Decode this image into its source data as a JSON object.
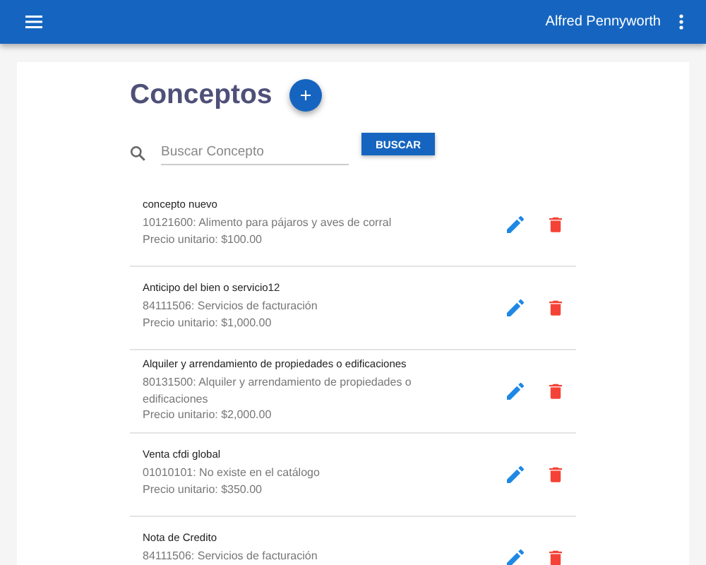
{
  "app_bar": {
    "user_name": "Alfred Pennyworth"
  },
  "page": {
    "title": "Conceptos"
  },
  "search": {
    "placeholder": "Buscar Concepto",
    "button": "BUSCAR"
  },
  "items": [
    {
      "name": "concepto nuevo",
      "code": "10121600: Alimento para pájaros y aves de corral",
      "price": "Precio unitario: $100.00"
    },
    {
      "name": "Anticipo del bien o servicio12",
      "code": "84111506: Servicios de facturación",
      "price": "Precio unitario: $1,000.00"
    },
    {
      "name": "Alquiler y arrendamiento de propiedades o edificaciones",
      "code": "80131500: Alquiler y arrendamiento de propiedades o edificaciones",
      "price": "Precio unitario: $2,000.00"
    },
    {
      "name": "Venta cfdi global",
      "code": "01010101: No existe en el catálogo",
      "price": "Precio unitario: $350.00"
    },
    {
      "name": "Nota de Credito",
      "code": "84111506: Servicios de facturación"
    }
  ]
}
